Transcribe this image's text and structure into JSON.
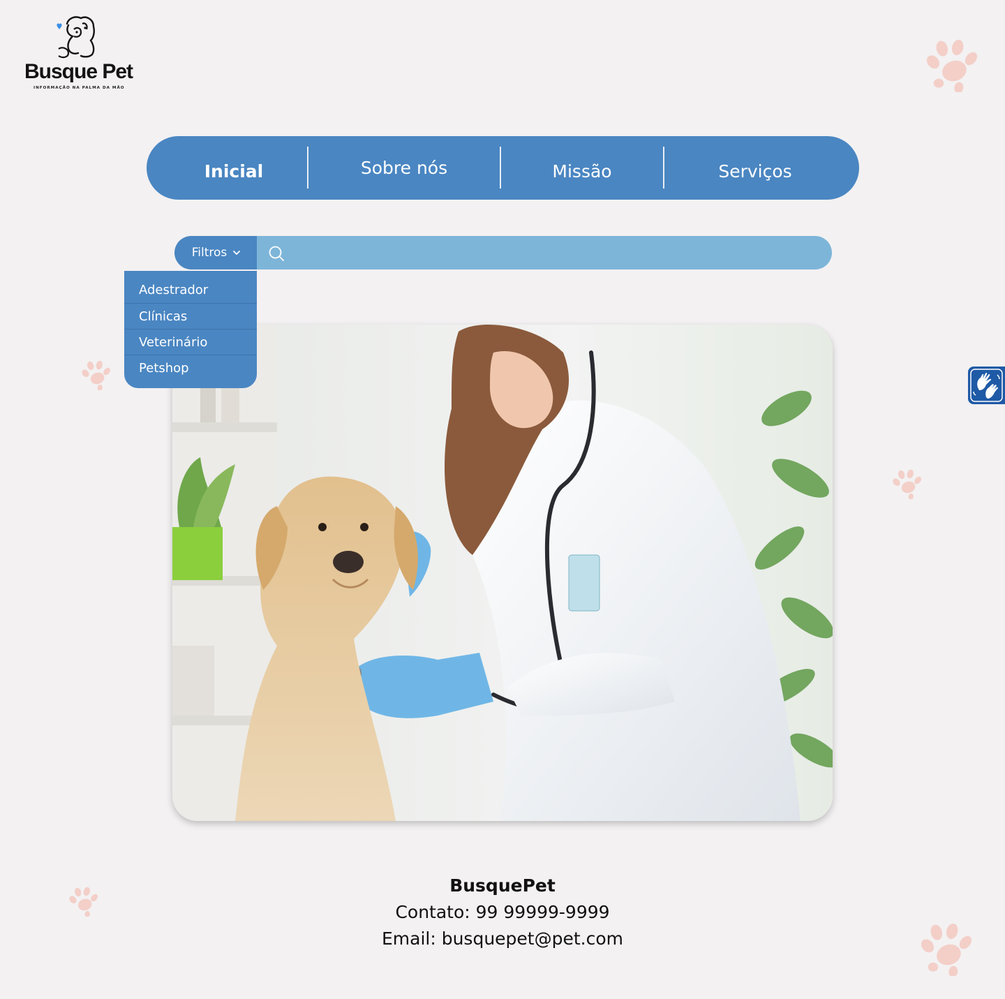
{
  "brand": {
    "name": "Busque Pet",
    "tagline": "INFORMAÇÃO NA PALMA DA MÃO"
  },
  "nav": {
    "items": [
      {
        "label": "Inicial",
        "active": true
      },
      {
        "label": "Sobre nós",
        "active": false
      },
      {
        "label": "Missão",
        "active": false
      },
      {
        "label": "Serviços",
        "active": false
      }
    ]
  },
  "search": {
    "filters_label": "Filtros",
    "placeholder": "",
    "value": ""
  },
  "filters_menu": {
    "options": [
      "Adestrador",
      "Clínicas",
      "Veterinário",
      "Petshop"
    ]
  },
  "hero": {
    "icon": "veterinarian-dog-photo"
  },
  "accessibility": {
    "icon": "sign-language-icon"
  },
  "footer": {
    "brand": "BusquePet",
    "contact": "Contato: 99 99999-9999",
    "email": "Email: busquepet@pet.com"
  },
  "colors": {
    "primary": "#4a86c2",
    "search_bar": "#7db5d9",
    "background": "#f3f1f2",
    "paw": "#f3cfc8",
    "accessibility": "#1f5aa6"
  }
}
